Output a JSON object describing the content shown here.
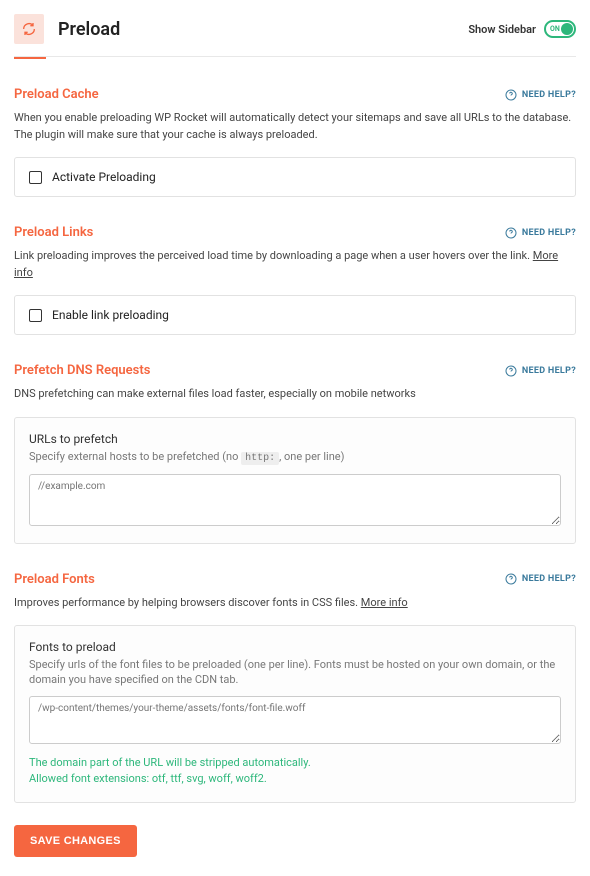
{
  "header": {
    "title": "Preload",
    "sidebar_label": "Show Sidebar",
    "toggle_state": "ON"
  },
  "need_help": "NEED HELP?",
  "preload_cache": {
    "title": "Preload Cache",
    "desc": "When you enable preloading WP Rocket will automatically detect your sitemaps and save all URLs to the database. The plugin will make sure that your cache is always preloaded.",
    "option": "Activate Preloading"
  },
  "preload_links": {
    "title": "Preload Links",
    "desc": "Link preloading improves the perceived load time by downloading a page when a user hovers over the link. ",
    "more": "More info",
    "option": "Enable link preloading"
  },
  "prefetch_dns": {
    "title": "Prefetch DNS Requests",
    "desc": "DNS prefetching can make external files load faster, especially on mobile networks",
    "form_title": "URLs to prefetch",
    "form_desc_pre": "Specify external hosts to be prefetched (no ",
    "form_desc_code": "http:",
    "form_desc_post": ", one per line)",
    "placeholder": "//example.com"
  },
  "preload_fonts": {
    "title": "Preload Fonts",
    "desc": "Improves performance by helping browsers discover fonts in CSS files. ",
    "more": "More info",
    "form_title": "Fonts to preload",
    "form_desc": "Specify urls of the font files to be preloaded (one per line). Fonts must be hosted on your own domain, or the domain you have specified on the CDN tab.",
    "placeholder": "/wp-content/themes/your-theme/assets/fonts/font-file.woff",
    "hint1": "The domain part of the URL will be stripped automatically.",
    "hint2": "Allowed font extensions: otf, ttf, svg, woff, woff2."
  },
  "save": "SAVE CHANGES"
}
